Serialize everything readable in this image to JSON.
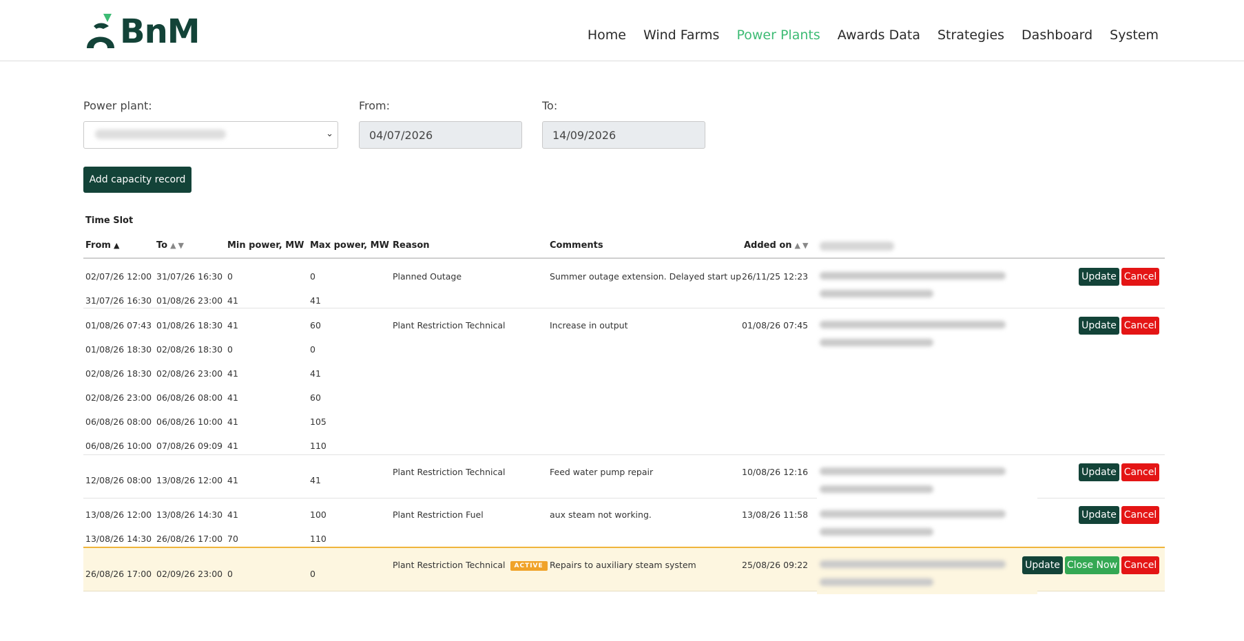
{
  "brand": {
    "logo_text": "BnM",
    "accent": "#3dbb74",
    "primary": "#134338"
  },
  "nav": {
    "items": [
      "Home",
      "Wind Farms",
      "Power Plants",
      "Awards Data",
      "Strategies",
      "Dashboard",
      "System"
    ],
    "active": "Power Plants"
  },
  "filters": {
    "power_plant_label": "Power plant:",
    "from_label": "From:",
    "from_value": "04/07/2026",
    "to_label": "To:",
    "to_value": "14/09/2026"
  },
  "actions": {
    "add_label": "Add capacity record"
  },
  "table": {
    "group_header": "Time Slot",
    "columns": {
      "from": "From",
      "to": "To",
      "min": "Min power, MW",
      "max": "Max power, MW",
      "reason": "Reason",
      "comments": "Comments",
      "added": "Added on"
    },
    "records": [
      {
        "slots": [
          {
            "from": "02/07/26 12:00",
            "to": "31/07/26 16:30",
            "min": "0",
            "max": "0"
          },
          {
            "from": "31/07/26 16:30",
            "to": "01/08/26 23:00",
            "min": "41",
            "max": "41"
          }
        ],
        "reason": "Planned Outage",
        "comments": "Summer outage extension. Delayed start up",
        "added": "26/11/25 12:23"
      },
      {
        "slots": [
          {
            "from": "01/08/26 07:43",
            "to": "01/08/26 18:30",
            "min": "41",
            "max": "60"
          },
          {
            "from": "01/08/26 18:30",
            "to": "02/08/26 18:30",
            "min": "0",
            "max": "0"
          },
          {
            "from": "02/08/26 18:30",
            "to": "02/08/26 23:00",
            "min": "41",
            "max": "41"
          },
          {
            "from": "02/08/26 23:00",
            "to": "06/08/26 08:00",
            "min": "41",
            "max": "60"
          },
          {
            "from": "06/08/26 08:00",
            "to": "06/08/26 10:00",
            "min": "41",
            "max": "105"
          },
          {
            "from": "06/08/26 10:00",
            "to": "07/08/26 09:09",
            "min": "41",
            "max": "110"
          }
        ],
        "reason": "Plant Restriction Technical",
        "comments": "Increase in output",
        "added": "01/08/26 07:45"
      },
      {
        "slots": [
          {
            "from": "12/08/26 08:00",
            "to": "13/08/26 12:00",
            "min": "41",
            "max": "41"
          }
        ],
        "reason": "Plant Restriction Technical",
        "comments": "Feed water pump repair",
        "added": "10/08/26 12:16"
      },
      {
        "slots": [
          {
            "from": "13/08/26 12:00",
            "to": "13/08/26 14:30",
            "min": "41",
            "max": "100"
          },
          {
            "from": "13/08/26 14:30",
            "to": "26/08/26 17:00",
            "min": "70",
            "max": "110"
          }
        ],
        "reason": "Plant Restriction Fuel",
        "comments": "aux steam not working.",
        "added": "13/08/26 11:58"
      },
      {
        "slots": [
          {
            "from": "26/08/26 17:00",
            "to": "02/09/26 23:00",
            "min": "0",
            "max": "0"
          }
        ],
        "reason": "Plant Restriction Technical",
        "badge": "ACTIVE",
        "comments": "Repairs to auxiliary steam system",
        "added": "25/08/26 09:22"
      }
    ],
    "buttons": {
      "update": "Update",
      "cancel": "Cancel",
      "close_now": "Close Now"
    }
  }
}
